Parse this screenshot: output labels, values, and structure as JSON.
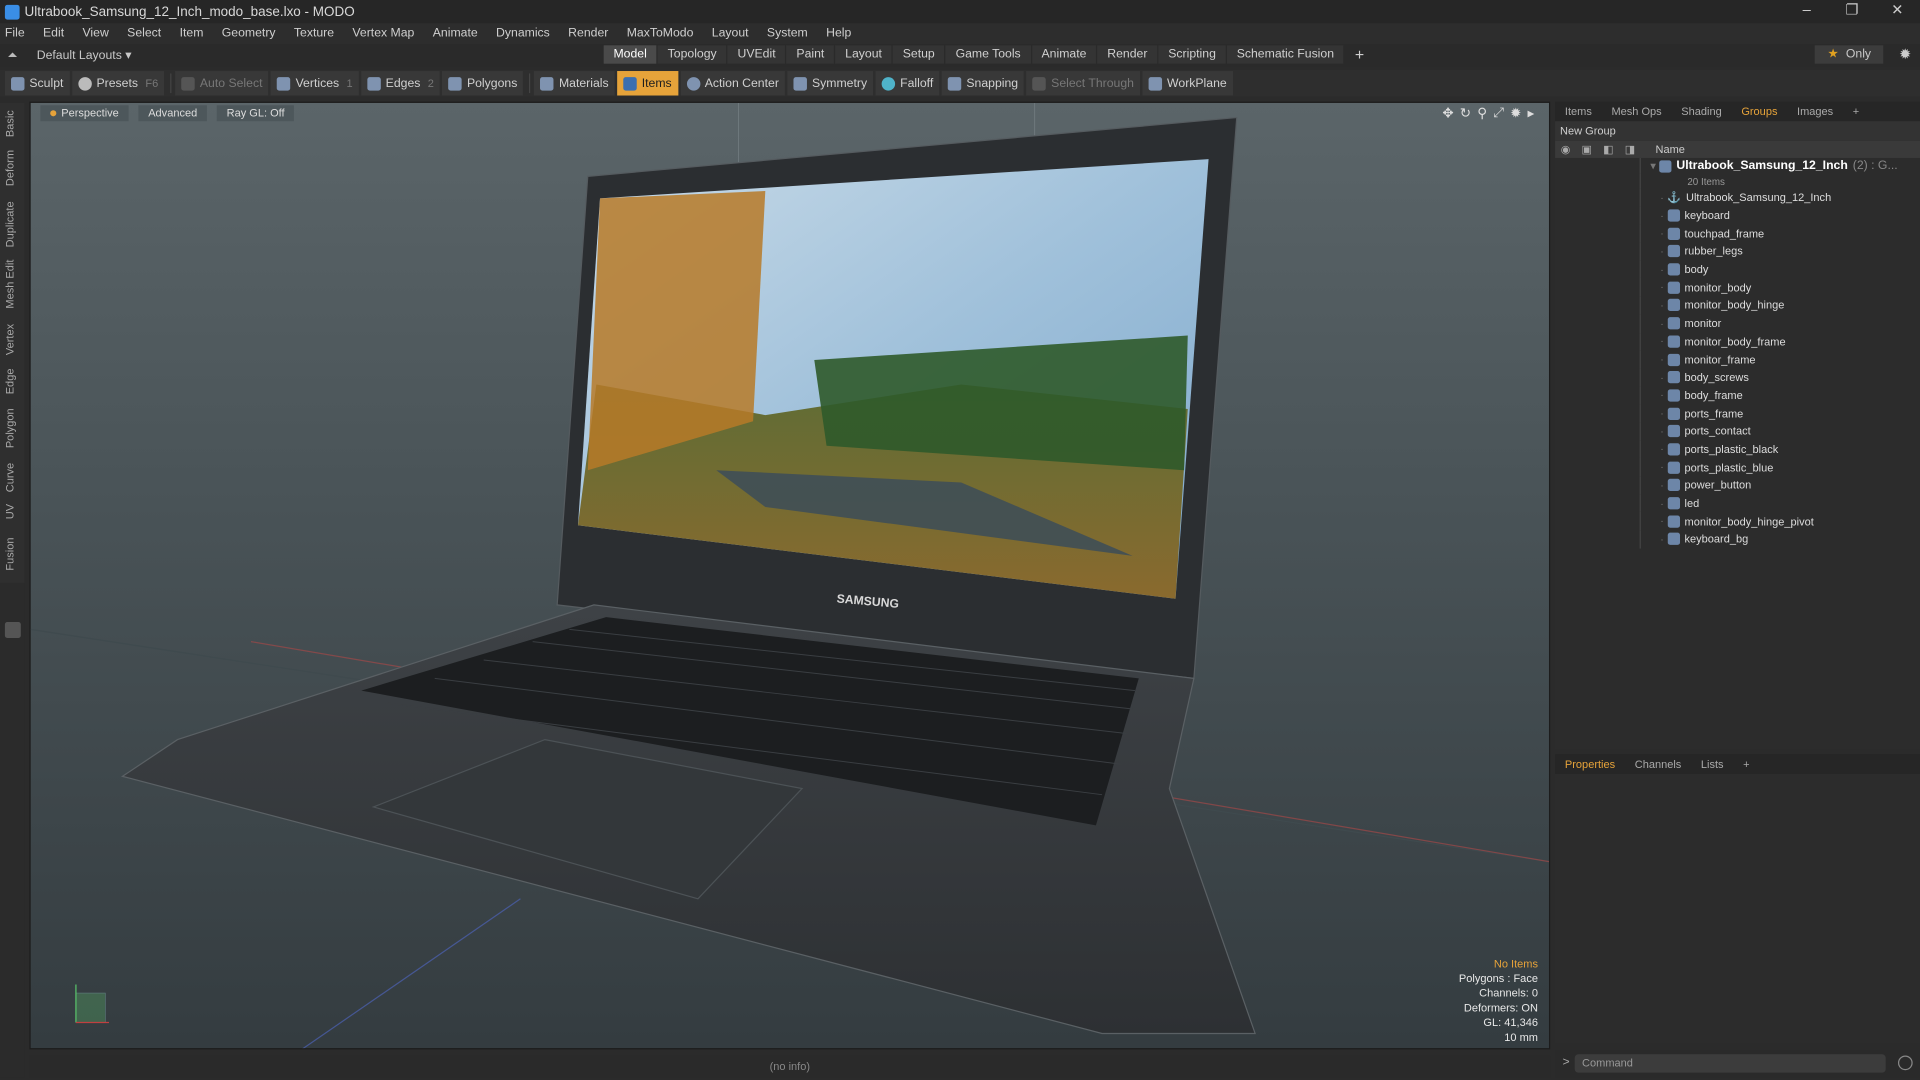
{
  "window": {
    "title": "Ultrabook_Samsung_12_Inch_modo_base.lxo - MODO",
    "min": "–",
    "max": "❐",
    "close": "✕"
  },
  "menu": [
    "File",
    "Edit",
    "View",
    "Select",
    "Item",
    "Geometry",
    "Texture",
    "Vertex Map",
    "Animate",
    "Dynamics",
    "Render",
    "MaxToModo",
    "Layout",
    "System",
    "Help"
  ],
  "layout": {
    "name": "Default Layouts ▾",
    "tabs": [
      "Model",
      "Topology",
      "UVEdit",
      "Paint",
      "Layout",
      "Setup",
      "Game Tools",
      "Animate",
      "Render",
      "Scripting",
      "Schematic Fusion"
    ],
    "active_tab": "Model",
    "only": "Only"
  },
  "toolbar": {
    "sculpt": "Sculpt",
    "presets": "Presets",
    "presets_key": "F6",
    "auto_select": "Auto Select",
    "vertices": "Vertices",
    "vertices_key": "1",
    "edges": "Edges",
    "edges_key": "2",
    "polygons": "Polygons",
    "materials": "Materials",
    "items": "Items",
    "action_center": "Action Center",
    "symmetry": "Symmetry",
    "falloff": "Falloff",
    "snapping": "Snapping",
    "select_through": "Select Through",
    "workplane": "WorkPlane"
  },
  "left_tabs": [
    "Basic",
    "Deform",
    "Duplicate",
    "Mesh Edit",
    "Vertex",
    "Edge",
    "Polygon",
    "Curve",
    "UV",
    "Fusion"
  ],
  "viewport": {
    "view": "Perspective",
    "mode": "Advanced",
    "raygl": "Ray GL: Off",
    "brand": "SAMSUNG",
    "info": {
      "warn": "No Items",
      "polygons": "Polygons : Face",
      "channels": "Channels: 0",
      "deformers": "Deformers: ON",
      "gl": "GL: 41,346",
      "scale": "10 mm"
    }
  },
  "status": "(no info)",
  "groups_panel": {
    "tabs": [
      "Items",
      "Mesh Ops",
      "Shading",
      "Groups",
      "Images",
      "+"
    ],
    "active_tab": "Groups",
    "new_group": "New Group",
    "name_header": "Name",
    "root": {
      "name": "Ultrabook_Samsung_12_Inch",
      "count": "(2) : G...",
      "sub": "20 Items"
    },
    "locator": "Ultrabook_Samsung_12_Inch",
    "items": [
      "keyboard",
      "touchpad_frame",
      "rubber_legs",
      "body",
      "monitor_body",
      "monitor_body_hinge",
      "monitor",
      "monitor_body_frame",
      "monitor_frame",
      "body_screws",
      "body_frame",
      "ports_frame",
      "ports_contact",
      "ports_plastic_black",
      "ports_plastic_blue",
      "power_button",
      "led",
      "monitor_body_hinge_pivot",
      "keyboard_bg"
    ]
  },
  "props_panel": {
    "tabs": [
      "Properties",
      "Channels",
      "Lists",
      "+"
    ],
    "active_tab": "Properties"
  },
  "command": {
    "prompt": ">",
    "placeholder": "Command"
  }
}
